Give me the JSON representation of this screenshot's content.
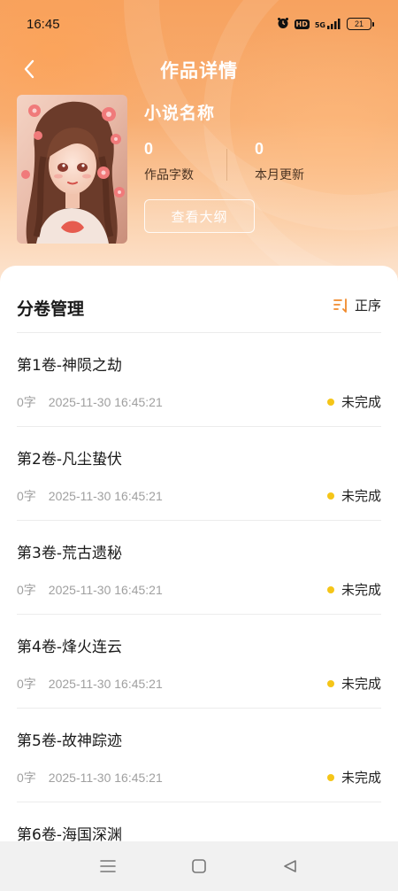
{
  "status_bar": {
    "time": "16:45",
    "hd_label": "HD",
    "network_label": "5G",
    "battery": "21"
  },
  "header": {
    "title": "作品详情",
    "back_icon": "chevron-left-icon"
  },
  "work": {
    "name": "小说名称",
    "word_count_value": "0",
    "word_count_label": "作品字数",
    "monthly_update_value": "0",
    "monthly_update_label": "本月更新",
    "outline_button": "查看大纲"
  },
  "volumes_section": {
    "title": "分卷管理",
    "sort_label": "正序",
    "sort_icon": "sort-ascending-icon",
    "status_color": "#f5c518",
    "items": [
      {
        "title": "第1卷-神陨之劫",
        "words": "0字",
        "date": "2025-11-30 16:45:21",
        "status": "未完成"
      },
      {
        "title": "第2卷-凡尘蛰伏",
        "words": "0字",
        "date": "2025-11-30 16:45:21",
        "status": "未完成"
      },
      {
        "title": "第3卷-荒古遗秘",
        "words": "0字",
        "date": "2025-11-30 16:45:21",
        "status": "未完成"
      },
      {
        "title": "第4卷-烽火连云",
        "words": "0字",
        "date": "2025-11-30 16:45:21",
        "status": "未完成"
      },
      {
        "title": "第5卷-故神踪迹",
        "words": "0字",
        "date": "2025-11-30 16:45:21",
        "status": "未完成"
      },
      {
        "title": "第6卷-海国深渊",
        "words": "",
        "date": "",
        "status": ""
      }
    ]
  },
  "colors": {
    "accent": "#f7a25f",
    "sort_icon": "#f08a2c"
  },
  "system_nav": {
    "menu_icon": "menu-icon",
    "home_icon": "home-square-icon",
    "back_icon": "back-triangle-icon"
  }
}
